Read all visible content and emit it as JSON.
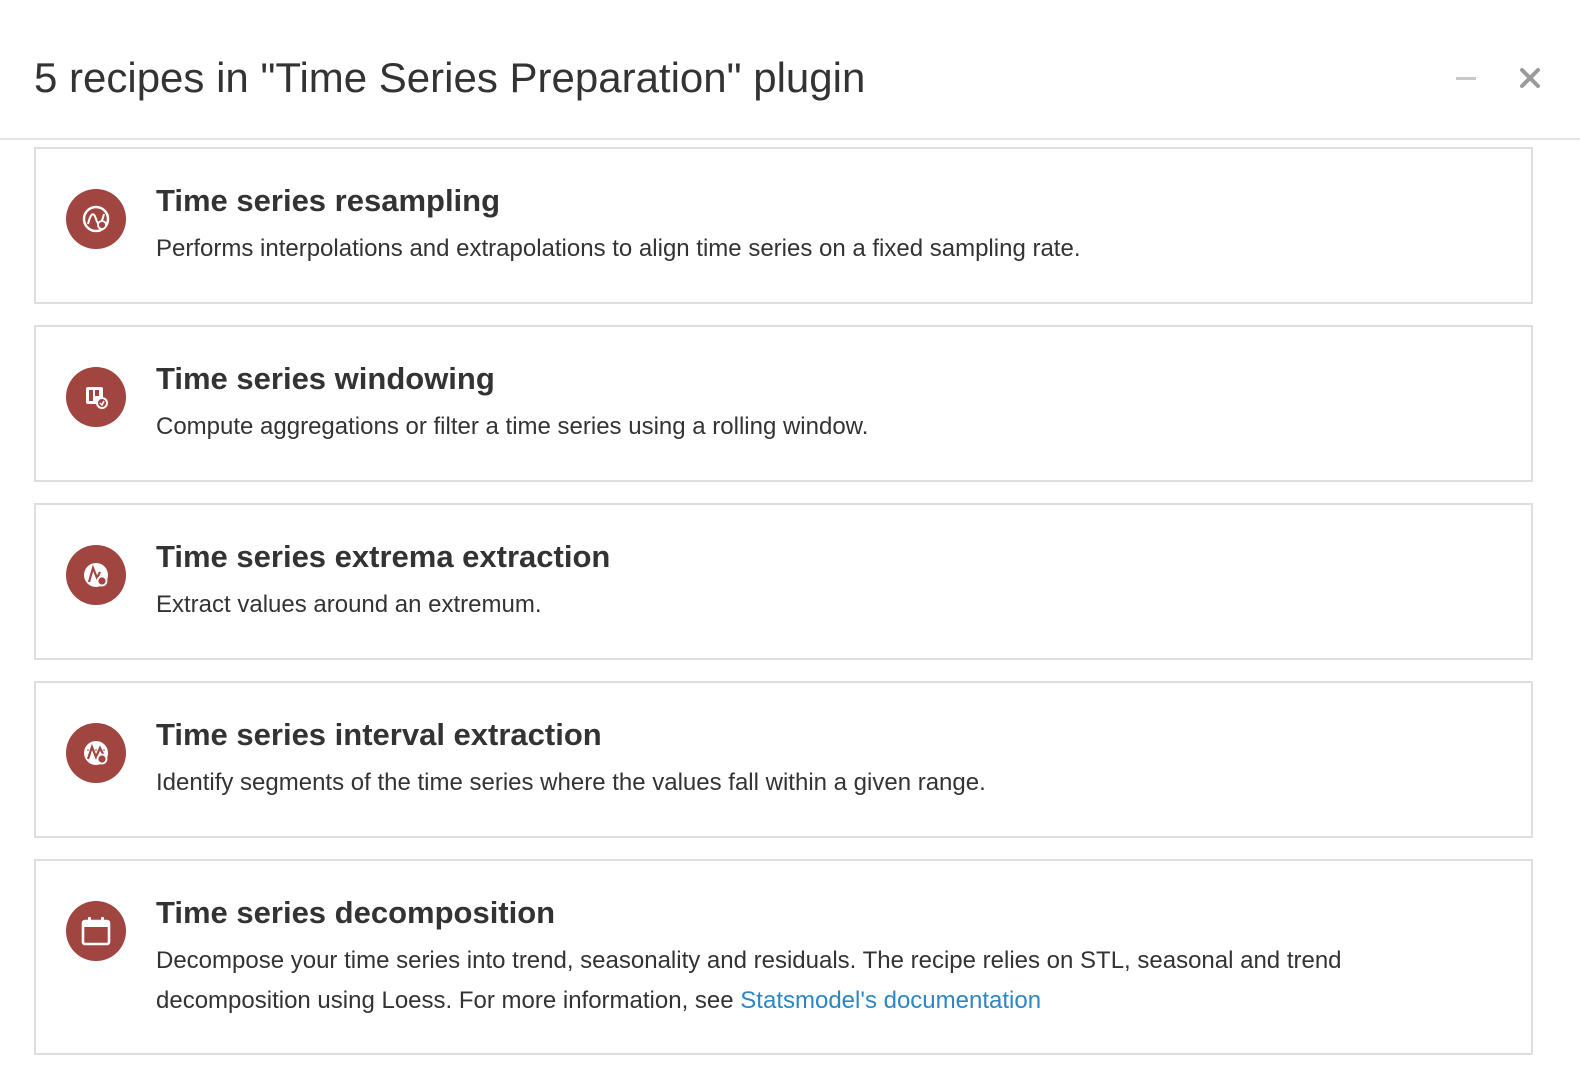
{
  "header": {
    "title": "5 recipes in \"Time Series Preparation\" plugin",
    "minimize_icon": "minus-icon",
    "close_icon": "close-icon"
  },
  "accent_color": "#a04540",
  "link_color": "#2d86c5",
  "recipes": [
    {
      "name": "Time series resampling",
      "icon": "resampling-icon",
      "description": "Performs interpolations and extrapolations to align time series on a fixed sampling rate."
    },
    {
      "name": "Time series windowing",
      "icon": "windowing-icon",
      "description": "Compute aggregations or filter a time series using a rolling window."
    },
    {
      "name": "Time series extrema extraction",
      "icon": "extrema-icon",
      "description": "Extract values around an extremum."
    },
    {
      "name": "Time series interval extraction",
      "icon": "interval-icon",
      "description": "Identify segments of the time series where the values fall within a given range."
    },
    {
      "name": "Time series decomposition",
      "icon": "calendar-icon",
      "description": "Decompose your time series into trend, seasonality and residuals. The recipe relies on STL, seasonal and trend decomposition using Loess. For more information, see ",
      "link_text": "Statsmodel's documentation"
    }
  ]
}
